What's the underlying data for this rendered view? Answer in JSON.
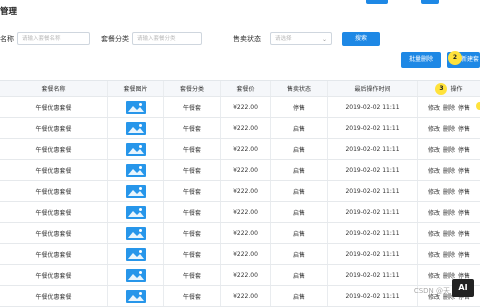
{
  "page": {
    "title": "管理"
  },
  "filters": {
    "name_label": "名称",
    "name_placeholder": "请输入套餐名称",
    "category_label": "套餐分类",
    "category_placeholder": "请输入套餐分类",
    "status_label": "售卖状态",
    "status_placeholder": "请选择",
    "search_label": "搜索"
  },
  "actions": {
    "batch_delete_label": "批量删除",
    "new_label": "新建套",
    "badge_2": "2",
    "badge_3": "3"
  },
  "table": {
    "headers": [
      "套餐名称",
      "套餐图片",
      "套餐分类",
      "套餐价",
      "售卖状态",
      "最后操作时间",
      "操作"
    ],
    "rows": [
      {
        "name": "午餐优惠套餐",
        "category": "午餐套",
        "price": "¥222.00",
        "status": "停售",
        "time": "2019-02-02 11:11",
        "ops": [
          "修改",
          "删除",
          "停售"
        ]
      },
      {
        "name": "午餐优惠套餐",
        "category": "午餐套",
        "price": "¥222.00",
        "status": "启售",
        "time": "2019-02-02 11:11",
        "ops": [
          "修改",
          "删除",
          "停售"
        ]
      },
      {
        "name": "午餐优惠套餐",
        "category": "午餐套",
        "price": "¥222.00",
        "status": "启售",
        "time": "2019-02-02 11:11",
        "ops": [
          "修改",
          "删除",
          "停售"
        ]
      },
      {
        "name": "午餐优惠套餐",
        "category": "午餐套",
        "price": "¥222.00",
        "status": "启售",
        "time": "2019-02-02 11:11",
        "ops": [
          "修改",
          "删除",
          "停售"
        ]
      },
      {
        "name": "午餐优惠套餐",
        "category": "午餐套",
        "price": "¥222.00",
        "status": "启售",
        "time": "2019-02-02 11:11",
        "ops": [
          "修改",
          "删除",
          "停售"
        ]
      },
      {
        "name": "午餐优惠套餐",
        "category": "午餐套",
        "price": "¥222.00",
        "status": "启售",
        "time": "2019-02-02 11:11",
        "ops": [
          "修改",
          "删除",
          "停售"
        ]
      },
      {
        "name": "午餐优惠套餐",
        "category": "午餐套",
        "price": "¥222.00",
        "status": "启售",
        "time": "2019-02-02 11:11",
        "ops": [
          "修改",
          "删除",
          "停售"
        ]
      },
      {
        "name": "午餐优惠套餐",
        "category": "午餐套",
        "price": "¥222.00",
        "status": "启售",
        "time": "2019-02-02 11:11",
        "ops": [
          "修改",
          "删除",
          "停售"
        ]
      },
      {
        "name": "午餐优惠套餐",
        "category": "午餐套",
        "price": "¥222.00",
        "status": "启售",
        "time": "2019-02-02 11:11",
        "ops": [
          "修改",
          "删除",
          "停售"
        ]
      },
      {
        "name": "午餐优惠套餐",
        "category": "午餐套",
        "price": "¥222.00",
        "status": "启售",
        "time": "2019-02-02 11:11",
        "ops": [
          "修改",
          "删除",
          "停售"
        ]
      }
    ]
  },
  "watermark": {
    "text": "CSDN @天",
    "logo": "AI"
  },
  "colors": {
    "accent": "#1e88e5",
    "badge": "#ffe23b",
    "image_placeholder": "#2796ea",
    "header_bg": "#f5f7fa"
  }
}
